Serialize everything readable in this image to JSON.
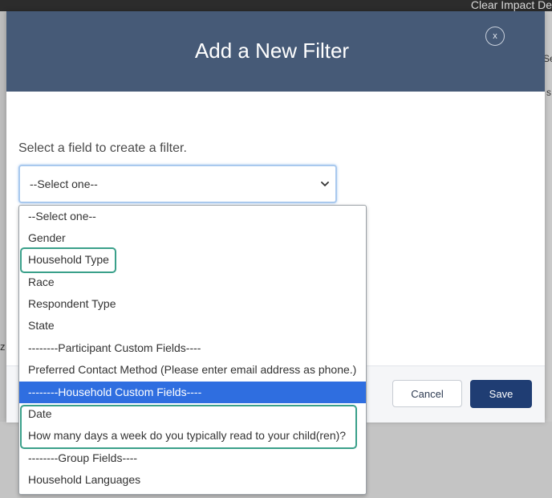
{
  "background": {
    "title_fragment": "Clear Impact De",
    "right_fragment_1": "Se",
    "right_fragment_2": "s",
    "left_fragment": "z"
  },
  "modal": {
    "title": "Add a New Filter",
    "close_label": "x",
    "prompt": "Select a field to create a filter.",
    "select_value": "--Select one--",
    "cancel_label": "Cancel",
    "save_label": "Save"
  },
  "dropdown": {
    "options": [
      {
        "label": "--Select one--"
      },
      {
        "label": "Gender"
      },
      {
        "label": "Household Type"
      },
      {
        "label": "Race"
      },
      {
        "label": "Respondent Type"
      },
      {
        "label": "State"
      },
      {
        "label": "--------Participant Custom Fields----"
      },
      {
        "label": "Preferred Contact Method (Please enter email address as phone.)"
      },
      {
        "label": "--------Household Custom Fields----",
        "selected": true
      },
      {
        "label": "Date"
      },
      {
        "label": "How many days a week do you typically read to your child(ren)?"
      },
      {
        "label": "--------Group Fields----"
      },
      {
        "label": "Household Languages"
      }
    ]
  },
  "colors": {
    "header": "#465a77",
    "selected_option": "#2f6ee0",
    "highlight": "#3aa08a",
    "save_button": "#1f3d73"
  }
}
